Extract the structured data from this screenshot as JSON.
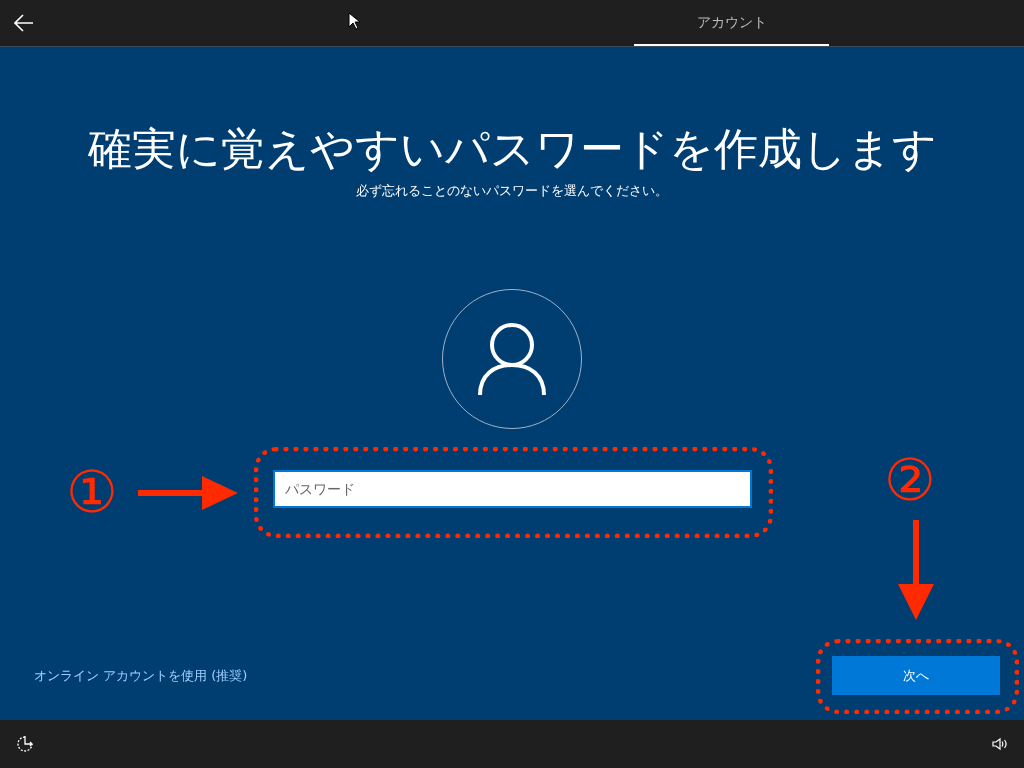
{
  "top_bar": {
    "tabs": [
      {
        "label": "アカウント",
        "selected": true
      }
    ]
  },
  "heading": "確実に覚えやすいパスワードを作成します",
  "subheading": "必ず忘れることのないパスワードを選んでください。",
  "password_field": {
    "placeholder": "パスワード"
  },
  "online_account_link": "オンライン アカウントを使用 (推奨)",
  "next_button": "次へ",
  "annotations": [
    {
      "label": "①"
    },
    {
      "label": "②"
    }
  ]
}
